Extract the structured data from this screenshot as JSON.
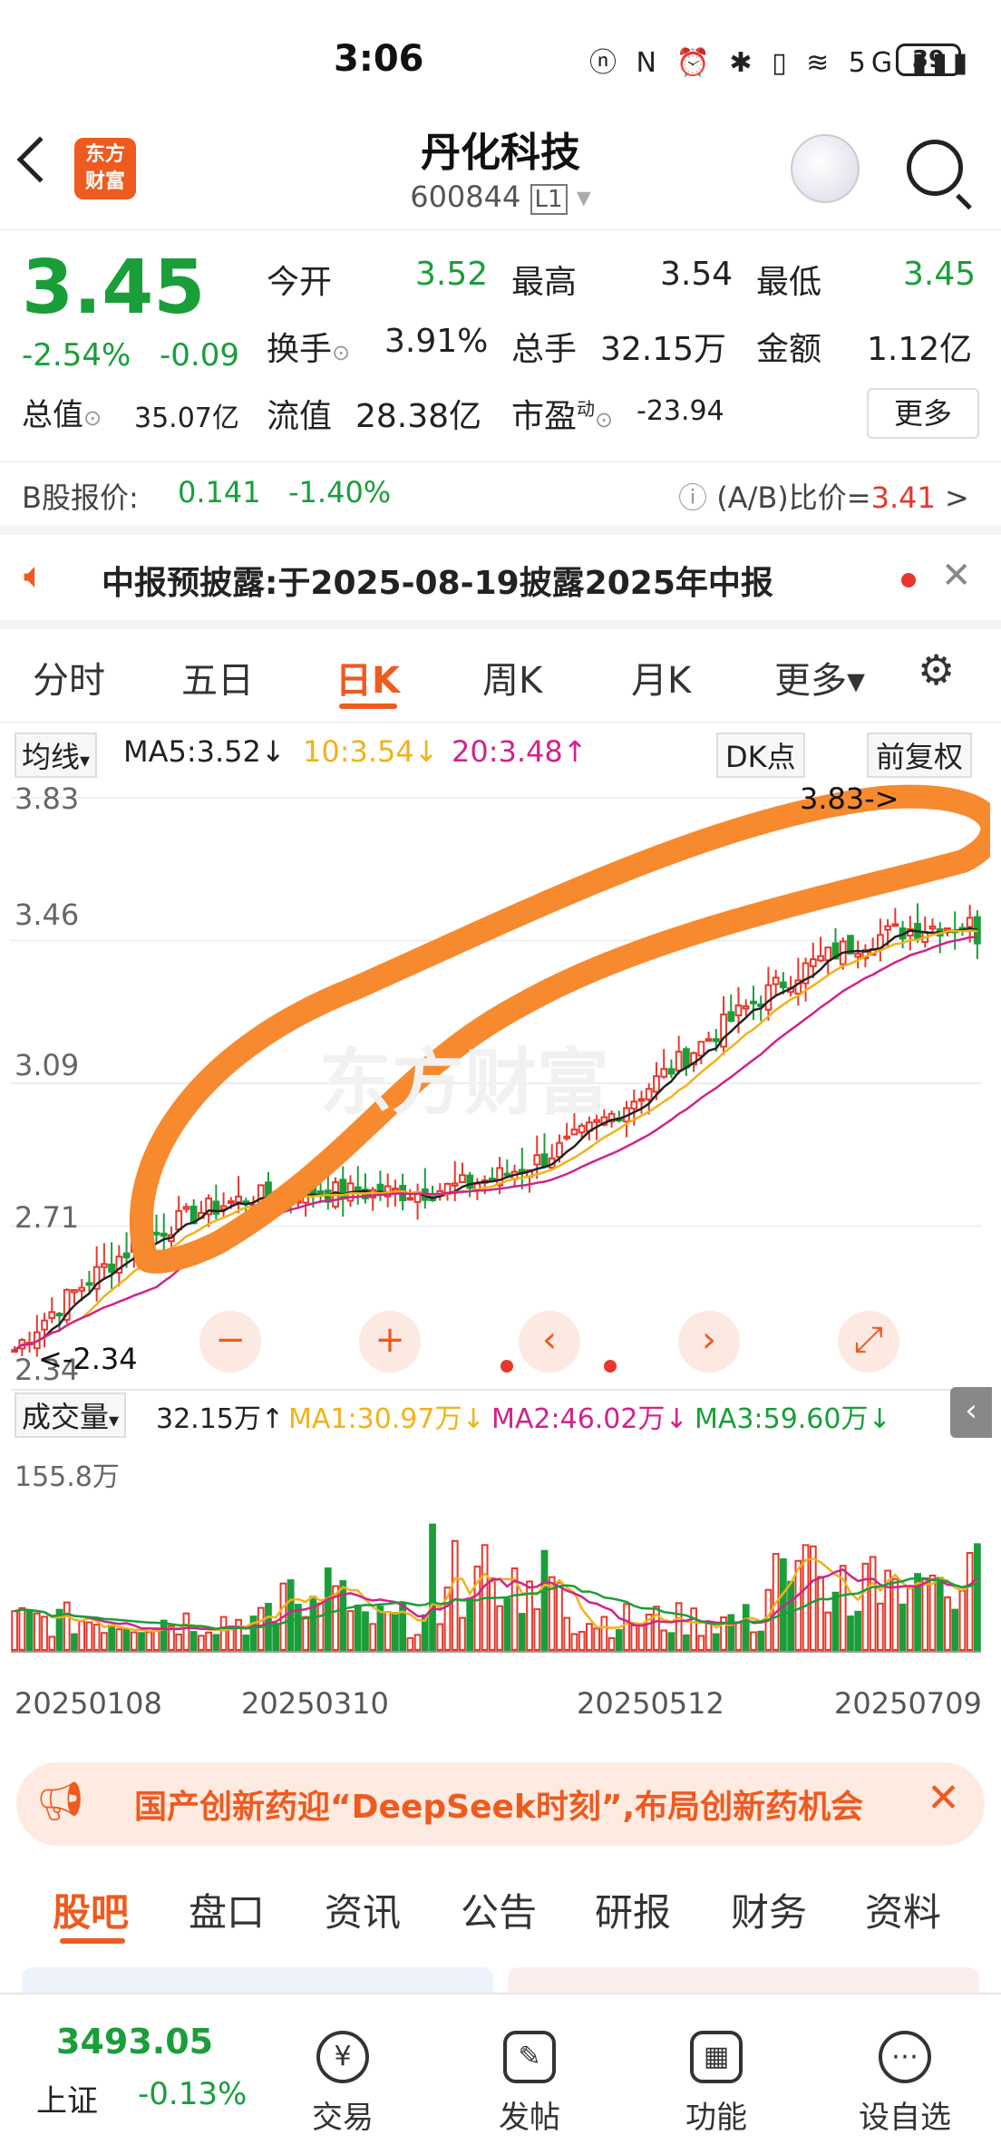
{
  "status": {
    "time": "3:06",
    "icons": "ⓝ N ⏰ ✱ ▯ ≋ 5G ▮▮▮",
    "battery": "39"
  },
  "header": {
    "logo_line1": "东方",
    "logo_line2": "财富",
    "title": "丹化科技",
    "code": "600844",
    "level": "L1"
  },
  "quote": {
    "price": "3.45",
    "change_pct": "-2.54%",
    "change": "-0.09",
    "labels": {
      "open": "今开",
      "high": "最高",
      "low": "最低",
      "turnover": "换手",
      "volume": "总手",
      "amount": "金额",
      "mktcap": "总值",
      "float": "流值",
      "pe": "市盈",
      "pe_sup": "动"
    },
    "values": {
      "open": "3.52",
      "high": "3.54",
      "low": "3.45",
      "turnover": "3.91%",
      "volume": "32.15万",
      "amount": "1.12亿",
      "mktcap": "35.07亿",
      "float": "28.38亿",
      "pe": "-23.94"
    },
    "more": "更多"
  },
  "bshare": {
    "label": "B股报价:",
    "price": "0.141",
    "pct": "-1.40%",
    "ratio_label": "(A/B)比价=",
    "ratio": "3.41"
  },
  "notice": {
    "text": "中报预披露:于2025-08-19披露2025年中报"
  },
  "tabs": [
    "分时",
    "五日",
    "日K",
    "周K",
    "月K",
    "更多▾"
  ],
  "chart": {
    "ma_selector": "均线",
    "ma5": "MA5:3.52↓",
    "ma10": "10:3.54↓",
    "ma20": "20:3.48↑",
    "dk": "DK点",
    "fq": "前复权",
    "y_ticks": [
      "3.83",
      "3.46",
      "3.09",
      "2.71",
      "2.34"
    ],
    "high_marker": "3.83->",
    "low_marker": "<-2.34",
    "watermark": "东方财富",
    "vol_selector": "成交量",
    "vol_val": "32.15万↑",
    "vma1": "MA1:30.97万↓",
    "vma2": "MA2:46.02万↓",
    "vma3": "MA3:59.60万↓",
    "vol_max": "155.8万",
    "dates": [
      "20250108",
      "20250310",
      "20250512",
      "20250709"
    ]
  },
  "chart_data": {
    "type": "candlestick",
    "y_range": [
      2.34,
      3.83
    ],
    "x_labels": [
      "20250108",
      "20250310",
      "20250512",
      "20250709"
    ],
    "last": {
      "close": 3.45,
      "open": 3.52,
      "high": 3.54,
      "low": 3.45
    },
    "ma": {
      "MA5": 3.52,
      "MA10": 3.54,
      "MA20": 3.48
    },
    "volume": {
      "last": "32.15万",
      "MA1": "30.97万",
      "MA2": "46.02万",
      "MA3": "59.60万",
      "max": "155.8万"
    }
  },
  "banner": {
    "text": "国产创新药迎“DeepSeek时刻”,布局创新药机会"
  },
  "bottom_tabs": [
    "股吧",
    "盘口",
    "资讯",
    "公告",
    "研报",
    "财务",
    "资料"
  ],
  "nav": {
    "index_value": "3493.05",
    "index_name": "上证",
    "index_pct": "-0.13%",
    "items": [
      "交易",
      "发帖",
      "功能",
      "设自选"
    ],
    "icons": [
      "¥",
      "✎",
      "▦",
      "⋯"
    ]
  },
  "colors": {
    "up": "#e8372c",
    "down": "#1a9e3a",
    "accent": "#ef5a1f",
    "annotation": "#f7892f"
  }
}
